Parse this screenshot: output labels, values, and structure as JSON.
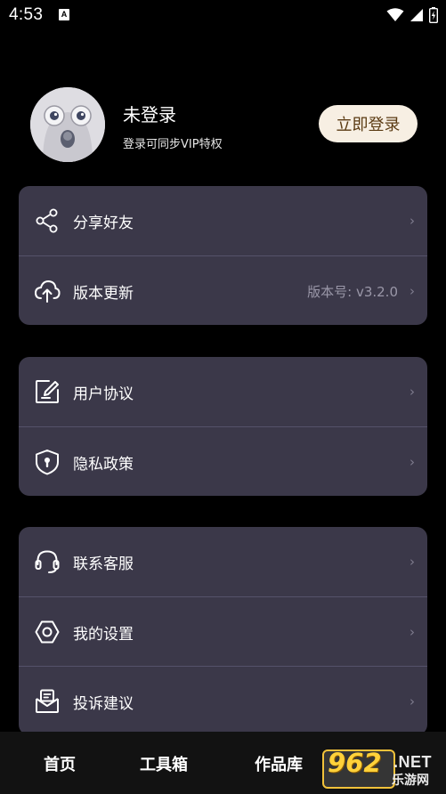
{
  "status_bar": {
    "time": "4:53",
    "notification_icon_letter": "A",
    "icons": [
      "wifi-icon",
      "signal-icon",
      "battery-icon"
    ]
  },
  "profile": {
    "name": "未登录",
    "subtitle": "登录可同步VIP特权",
    "login_button": "立即登录"
  },
  "groups": [
    {
      "items": [
        {
          "icon": "share-icon",
          "label": "分享好友",
          "value": ""
        },
        {
          "icon": "upload-cloud-icon",
          "label": "版本更新",
          "value": "版本号: v3.2.0"
        }
      ]
    },
    {
      "items": [
        {
          "icon": "edit-document-icon",
          "label": "用户协议",
          "value": ""
        },
        {
          "icon": "shield-icon",
          "label": "隐私政策",
          "value": ""
        }
      ]
    },
    {
      "items": [
        {
          "icon": "headset-icon",
          "label": "联系客服",
          "value": ""
        },
        {
          "icon": "settings-hexagon-icon",
          "label": "我的设置",
          "value": ""
        },
        {
          "icon": "mail-icon",
          "label": "投诉建议",
          "value": ""
        }
      ]
    }
  ],
  "chevron": "›",
  "tabs": [
    "首页",
    "工具箱",
    "作品库"
  ],
  "watermark": {
    "number": "962",
    "suffix": ".NET",
    "site": "乐游网"
  },
  "colors": {
    "card": "#3b3849",
    "login_button_bg": "#f7efe3",
    "login_button_text": "#5a3a12",
    "background": "#000000"
  }
}
